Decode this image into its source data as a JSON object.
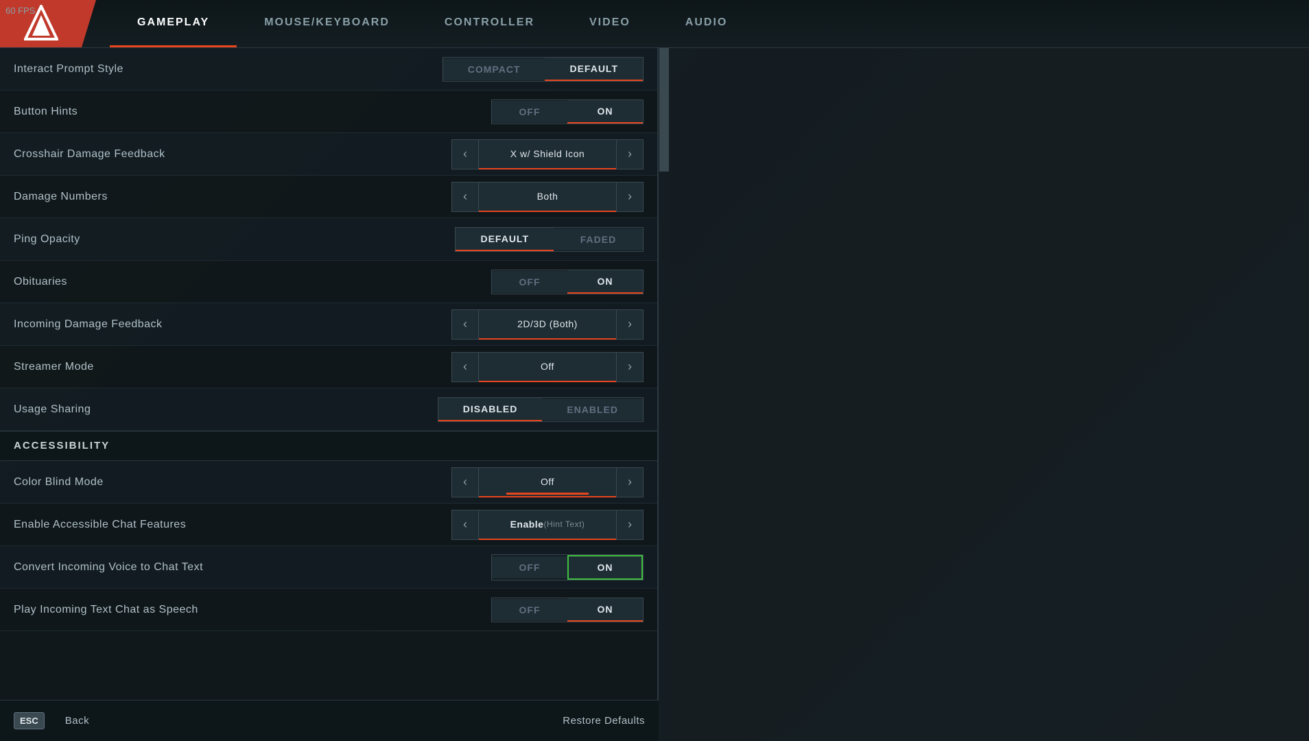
{
  "fps": "60 FPS",
  "nav": {
    "tabs": [
      {
        "id": "gameplay",
        "label": "GAMEPLAY",
        "active": true
      },
      {
        "id": "mouse-keyboard",
        "label": "MOUSE/KEYBOARD",
        "active": false
      },
      {
        "id": "controller",
        "label": "CONTROLLER",
        "active": false
      },
      {
        "id": "video",
        "label": "VIDEO",
        "active": false
      },
      {
        "id": "audio",
        "label": "AUDIO",
        "active": false
      }
    ]
  },
  "settings": {
    "rows": [
      {
        "id": "interact-prompt-style",
        "label": "Interact Prompt Style",
        "control_type": "toggle_pair",
        "options": [
          "Compact",
          "Default"
        ],
        "active": "Default"
      },
      {
        "id": "button-hints",
        "label": "Button Hints",
        "control_type": "toggle_pair",
        "options": [
          "Off",
          "On"
        ],
        "active": "On"
      },
      {
        "id": "crosshair-damage-feedback",
        "label": "Crosshair Damage Feedback",
        "control_type": "arrow_selector",
        "value": "X w/ Shield Icon"
      },
      {
        "id": "damage-numbers",
        "label": "Damage Numbers",
        "control_type": "arrow_selector",
        "value": "Both"
      },
      {
        "id": "ping-opacity",
        "label": "Ping Opacity",
        "control_type": "option_pair",
        "options": [
          "Default",
          "Faded"
        ],
        "active": "Default"
      },
      {
        "id": "obituaries",
        "label": "Obituaries",
        "control_type": "toggle_pair",
        "options": [
          "Off",
          "On"
        ],
        "active": "On"
      },
      {
        "id": "incoming-damage-feedback",
        "label": "Incoming Damage Feedback",
        "control_type": "arrow_selector",
        "value": "2D/3D (Both)"
      },
      {
        "id": "streamer-mode",
        "label": "Streamer Mode",
        "control_type": "arrow_selector",
        "value": "Off"
      },
      {
        "id": "usage-sharing",
        "label": "Usage Sharing",
        "control_type": "option_pair",
        "options": [
          "Disabled",
          "Enabled"
        ],
        "active": "Disabled"
      }
    ],
    "accessibility_section": {
      "title": "ACCESSIBILITY",
      "rows": [
        {
          "id": "color-blind-mode",
          "label": "Color Blind Mode",
          "control_type": "arrow_selector",
          "value": "Off"
        },
        {
          "id": "accessible-chat-features",
          "label": "Enable Accessible Chat Features",
          "control_type": "arrow_selector",
          "value": "Enable",
          "hint": "(Hint Text)"
        },
        {
          "id": "convert-voice-to-text",
          "label": "Convert Incoming Voice to Chat Text",
          "control_type": "toggle_pair",
          "options": [
            "Off",
            "On"
          ],
          "active": "On",
          "highlight": "green"
        },
        {
          "id": "play-text-as-speech",
          "label": "Play Incoming Text Chat as Speech",
          "control_type": "toggle_pair",
          "options": [
            "Off",
            "On"
          ],
          "active": "On"
        }
      ]
    }
  },
  "bottom_bar": {
    "esc_label": "ESC",
    "back_label": "Back",
    "restore_label": "Restore Defaults"
  },
  "icons": {
    "arrow_left": "‹",
    "arrow_right": "›",
    "logo": "▲"
  }
}
